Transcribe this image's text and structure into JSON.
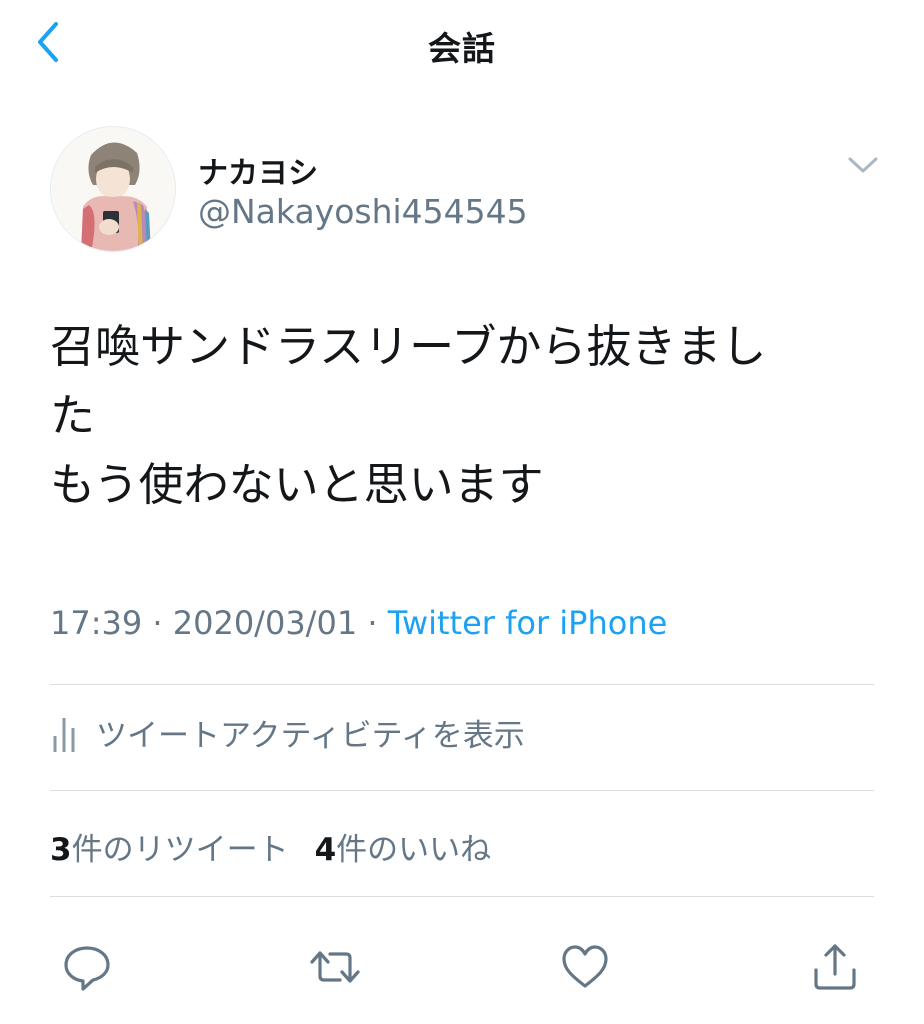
{
  "nav": {
    "title": "会話",
    "back_icon": "chevron-left-icon"
  },
  "author": {
    "display_name": "ナカヨシ",
    "handle": "@Nakayoshi454545"
  },
  "tweet": {
    "lines": [
      "召喚サンドラスリーブから抜きまし",
      "た",
      "もう使わないと思います"
    ]
  },
  "meta": {
    "time": "17:39",
    "sep1": " · ",
    "date": "2020/03/01",
    "sep2": " · ",
    "source": "Twitter for iPhone"
  },
  "activity": {
    "label": "ツイートアクティビティを表示",
    "icon": "bar-chart-icon"
  },
  "stats": {
    "retweet_count": "3",
    "retweet_label": "件のリツイート",
    "like_count": "4",
    "like_label": "件のいいね"
  },
  "actions": [
    "reply-icon",
    "retweet-icon",
    "like-icon",
    "share-icon"
  ],
  "colors": {
    "accent": "#1da1f2",
    "secondary_text": "#657786",
    "primary_text": "#14171a",
    "divider": "#d8dde1"
  }
}
